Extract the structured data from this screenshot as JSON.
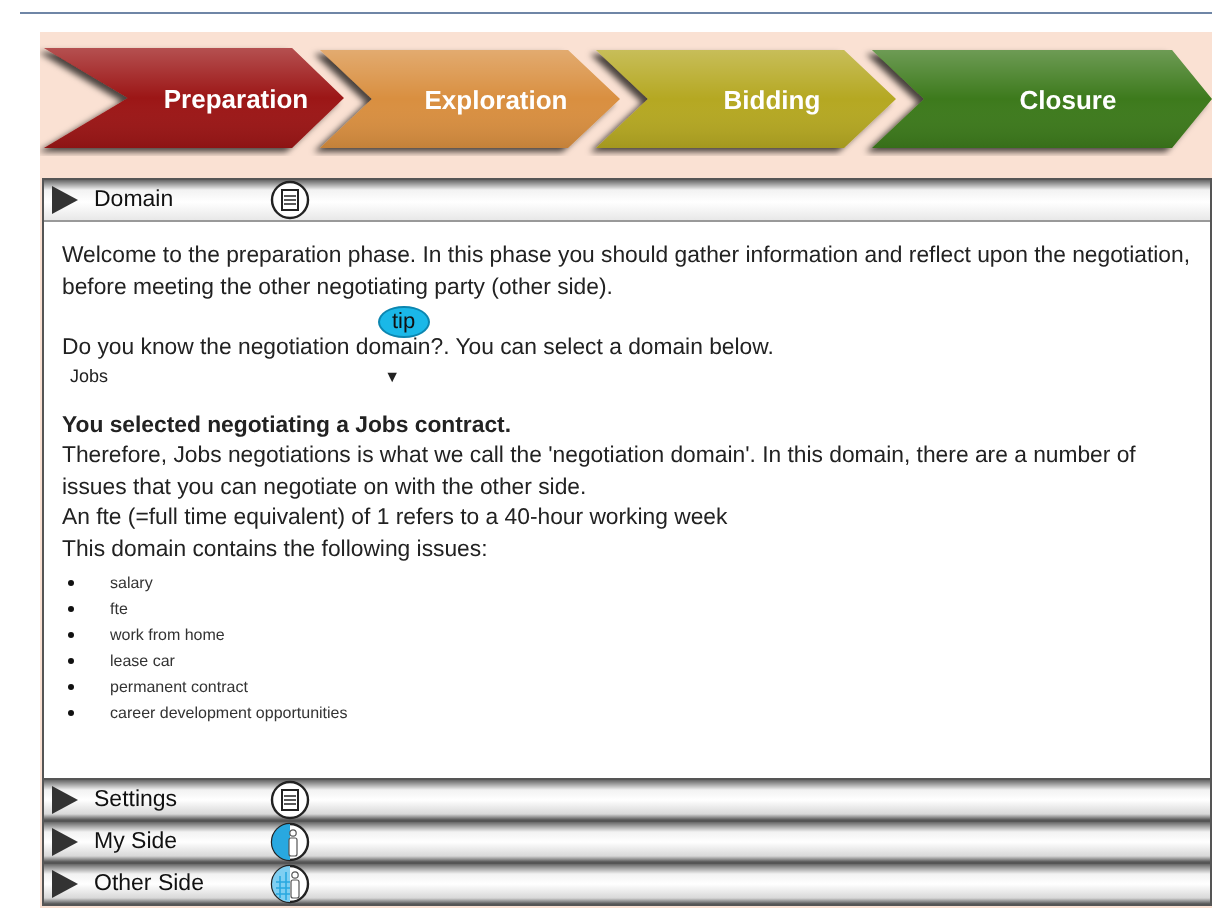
{
  "phases": [
    {
      "label": "Preparation",
      "color": "#9c1414"
    },
    {
      "label": "Exploration",
      "color": "#d98f3f"
    },
    {
      "label": "Bidding",
      "color": "#b5a824"
    },
    {
      "label": "Closure",
      "color": "#3c7a1a"
    }
  ],
  "sections": [
    {
      "label": "Domain",
      "kind": "document",
      "expanded": true,
      "intro": "Welcome to the preparation phase. In this phase you should gather information and reflect upon the negotiation, before meeting the other negotiating party (other side).",
      "question": "Do you know the negotiation domain?. You can select a domain below.",
      "tip": "tip",
      "domain_select": {
        "value": "Jobs",
        "arrow": "▼"
      },
      "selected_heading": "You selected negotiating a Jobs contract.",
      "explanation": [
        "Therefore, Jobs negotiations is what we call the 'negotiation domain'. In this domain, there are a number of issues that you can negotiate on with the other side.",
        "An fte (=full time equivalent) of 1 refers to a 40-hour working week",
        "This domain contains the following issues:"
      ],
      "issues": [
        "salary",
        "fte",
        "work from home",
        "lease car",
        "permanent contract",
        "career development opportunities"
      ]
    },
    {
      "label": "Settings",
      "kind": "document",
      "expanded": false
    },
    {
      "label": "My Side",
      "kind": "person",
      "expanded": false
    },
    {
      "label": "Other Side",
      "kind": "people",
      "expanded": false
    }
  ]
}
